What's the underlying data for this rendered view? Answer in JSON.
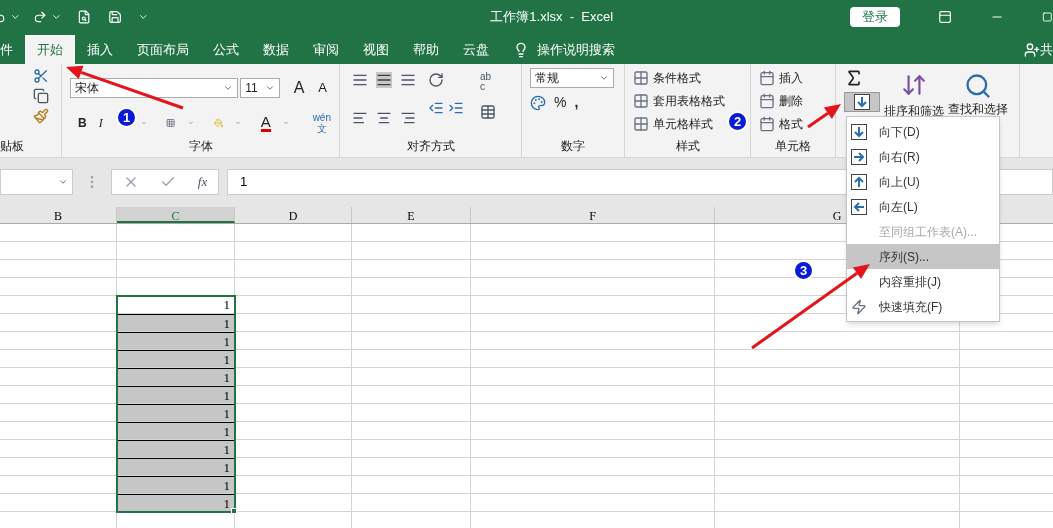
{
  "title_bar": {
    "title": "工作簿1.xlsx  -  Excel",
    "sign_in": "登录"
  },
  "tabs": [
    {
      "label": "件",
      "selected": false
    },
    {
      "label": "开始",
      "selected": true
    },
    {
      "label": "插入",
      "selected": false
    },
    {
      "label": "页面布局",
      "selected": false
    },
    {
      "label": "公式",
      "selected": false
    },
    {
      "label": "数据",
      "selected": false
    },
    {
      "label": "审阅",
      "selected": false
    },
    {
      "label": "视图",
      "selected": false
    },
    {
      "label": "帮助",
      "selected": false
    },
    {
      "label": "云盘",
      "selected": false
    }
  ],
  "tell_me": "操作说明搜索",
  "share": "共",
  "ribbon": {
    "clipboard_label": "贴板",
    "font": {
      "name": "宋体",
      "size": "11",
      "grow": "A",
      "shrink": "A",
      "bold": "B",
      "italic": "I",
      "color_letter": "A",
      "phonetic_top": "wén",
      "phonetic_bottom": "文",
      "label": "字体"
    },
    "alignment": {
      "wrap_top": "ab",
      "wrap_bottom": "c",
      "label": "对齐方式"
    },
    "number": {
      "format": "常规",
      "percent": "%",
      "comma": ",",
      "label": "数字"
    },
    "styles": {
      "items": [
        "条件格式",
        "套用表格格式",
        "单元格样式"
      ],
      "label": "样式"
    },
    "cells": {
      "items": [
        "插入",
        "删除",
        "格式"
      ],
      "label": "单元格"
    },
    "editing": {
      "sort": "排序和筛选",
      "find": "查找和选择"
    }
  },
  "formula_bar": {
    "fx": "fx",
    "value": "1"
  },
  "columns": [
    {
      "label": "B",
      "selected": false
    },
    {
      "label": "C",
      "selected": true
    },
    {
      "label": "D",
      "selected": false
    },
    {
      "label": "E",
      "selected": false
    },
    {
      "label": "F",
      "selected": false
    },
    {
      "label": "G",
      "selected": false
    }
  ],
  "selection": [
    {
      "value": "1",
      "active": true
    },
    {
      "value": "1",
      "active": false
    },
    {
      "value": "1",
      "active": false
    },
    {
      "value": "1",
      "active": false
    },
    {
      "value": "1",
      "active": false
    },
    {
      "value": "1",
      "active": false
    },
    {
      "value": "1",
      "active": false
    },
    {
      "value": "1",
      "active": false
    },
    {
      "value": "1",
      "active": false
    },
    {
      "value": "1",
      "active": false
    },
    {
      "value": "1",
      "active": false
    },
    {
      "value": "1",
      "active": false
    }
  ],
  "fill_menu": [
    {
      "label": "向下(D)",
      "kind": "down",
      "disabled": false,
      "selected": false
    },
    {
      "label": "向右(R)",
      "kind": "right",
      "disabled": false,
      "selected": false
    },
    {
      "label": "向上(U)",
      "kind": "up",
      "disabled": false,
      "selected": false
    },
    {
      "label": "向左(L)",
      "kind": "left",
      "disabled": false,
      "selected": false
    },
    {
      "label": "至同组工作表(A)...",
      "kind": "plain",
      "disabled": true,
      "selected": false
    },
    {
      "label": "序列(S)...",
      "kind": "plain",
      "disabled": false,
      "selected": true
    },
    {
      "label": "内容重排(J)",
      "kind": "plain",
      "disabled": false,
      "selected": false
    },
    {
      "label": "快速填充(F)",
      "kind": "flash",
      "disabled": false,
      "selected": false
    }
  ],
  "annotations": [
    {
      "number": "1"
    },
    {
      "number": "2"
    },
    {
      "number": "3"
    }
  ]
}
